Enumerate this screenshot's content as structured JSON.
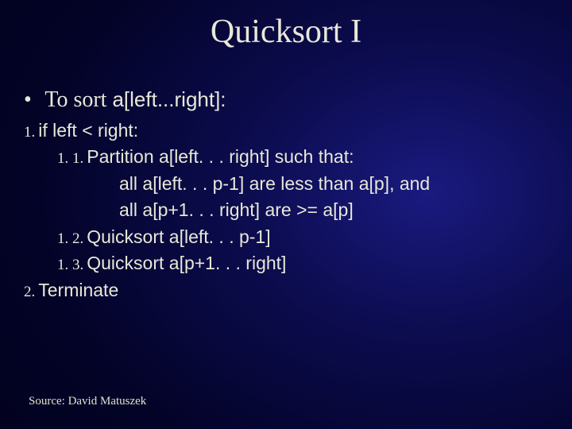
{
  "title": "Quicksort I",
  "bullet": {
    "prefix": "To sort ",
    "code": "a[left...right]:"
  },
  "lines": {
    "n1": "1.",
    "t1": "if left < right:",
    "n11": "1. 1.",
    "t11": "Partition a[left. . . right] such that:",
    "t11a": "all a[left. . . p-1] are less than a[p], and",
    "t11b": "all a[p+1. . . right] are >= a[p]",
    "n12": "1. 2.",
    "t12": "Quicksort a[left. . . p-1]",
    "n13": "1. 3.",
    "t13": "Quicksort a[p+1. . . right]",
    "n2": "2.",
    "t2": "Terminate"
  },
  "footer": "Source:  David Matuszek"
}
